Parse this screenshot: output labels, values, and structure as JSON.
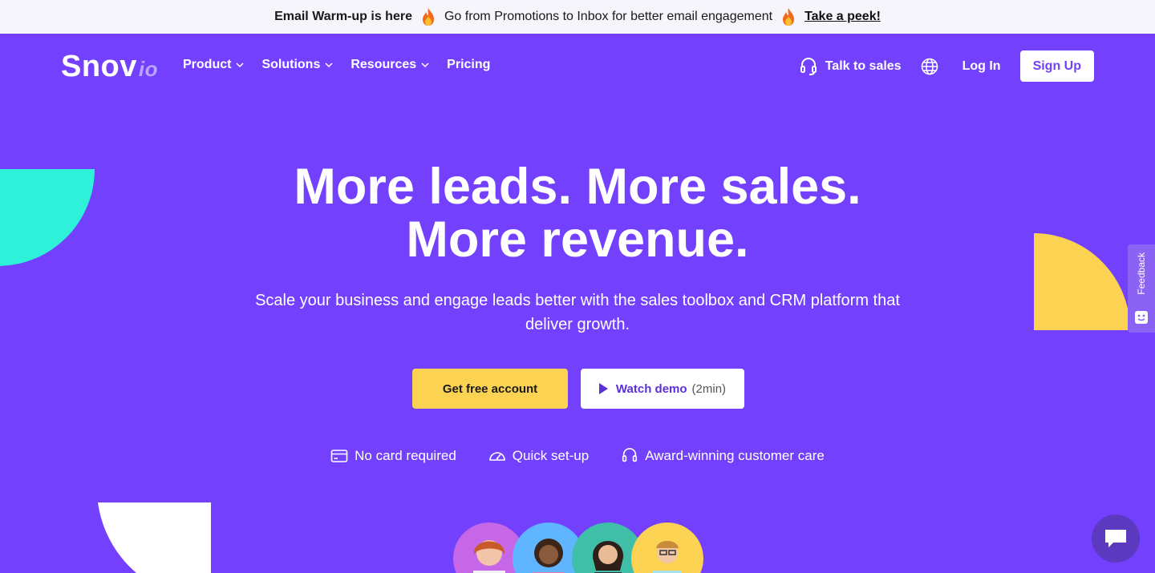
{
  "announcement": {
    "headline": "Email Warm-up is here",
    "message": "Go from Promotions to Inbox for better email engagement",
    "link": "Take a peek!"
  },
  "header": {
    "logo_main": "Snov",
    "logo_suffix": "io",
    "nav": [
      {
        "label": "Product",
        "has_dropdown": true
      },
      {
        "label": "Solutions",
        "has_dropdown": true
      },
      {
        "label": "Resources",
        "has_dropdown": true
      },
      {
        "label": "Pricing",
        "has_dropdown": false
      }
    ],
    "talk_to_sales": "Talk to sales",
    "login": "Log In",
    "signup": "Sign Up"
  },
  "hero": {
    "title_line1": "More leads. More sales.",
    "title_line2": "More revenue.",
    "subtitle": "Scale your business and engage leads better with the sales toolbox and CRM platform that deliver growth.",
    "cta_primary": "Get free account",
    "cta_secondary": "Watch demo",
    "cta_secondary_duration": "(2min)",
    "features": [
      {
        "icon": "credit-card-icon",
        "label": "No card required"
      },
      {
        "icon": "speedometer-icon",
        "label": "Quick set-up"
      },
      {
        "icon": "headset-icon",
        "label": "Award-winning customer care"
      }
    ]
  },
  "feedback": {
    "label": "Feedback"
  },
  "colors": {
    "brand_purple": "#7340fd",
    "accent_yellow": "#fbd252",
    "accent_teal": "#2ff0d9",
    "bar_bg": "#f5f5fb"
  }
}
